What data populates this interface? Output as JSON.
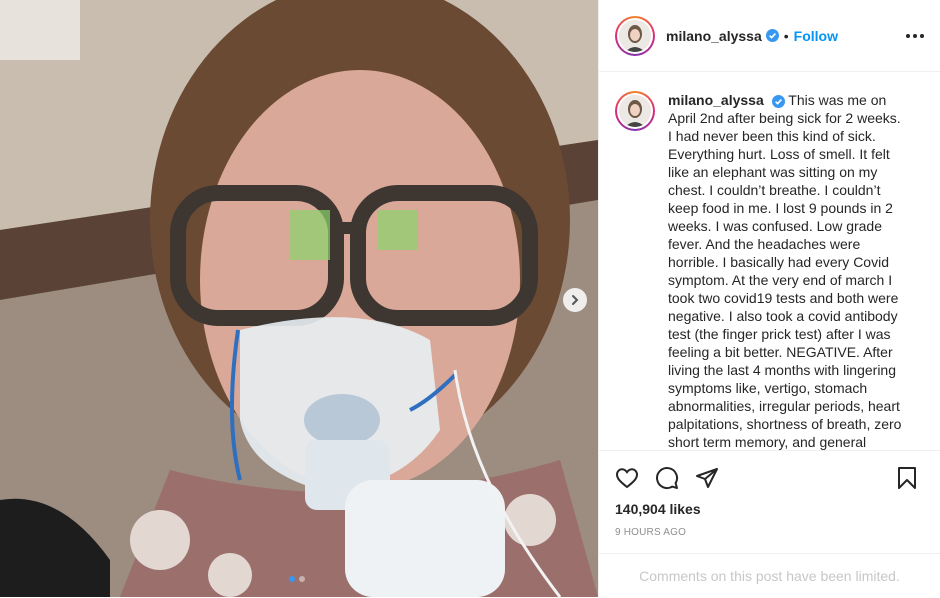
{
  "post": {
    "username": "milano_alyssa",
    "follow_label": "Follow",
    "separator": "•",
    "caption": "This was me on April 2nd after being sick for 2 weeks. I had never been this kind of sick. Everything hurt. Loss of smell. It felt like an elephant was sitting on my chest. I couldn’t breathe. I couldn’t keep food in me. I lost 9 pounds in 2 weeks. I was confused. Low grade fever. And the headaches were horrible. I basically had every Covid symptom. At the very end of march I took two covid19 tests and both were negative. I also took a covid antibody test (the finger prick test) after I was feeling a bit better. NEGATIVE. After living the last 4 months with lingering symptoms like, vertigo, stomach abnormalities, irregular periods, heart palpitations, shortness of breath, zero short term memory, and general malaise, I went",
    "likes": "140,904 likes",
    "timestamp": "9 HOURS AGO",
    "comments_notice": "Comments on this post have been limited.",
    "carousel": {
      "total": 2,
      "current": 1
    }
  },
  "icons": {
    "verified": "verified-badge-icon",
    "more": "more-options-icon",
    "like": "heart-icon",
    "comment": "comment-bubble-icon",
    "share": "paper-plane-icon",
    "save": "bookmark-icon",
    "next": "chevron-right-icon"
  },
  "colors": {
    "link_blue": "#0095f6",
    "verified_blue": "#3897f0",
    "text": "#262626",
    "muted": "#8e8e8e",
    "divider": "#efefef"
  }
}
